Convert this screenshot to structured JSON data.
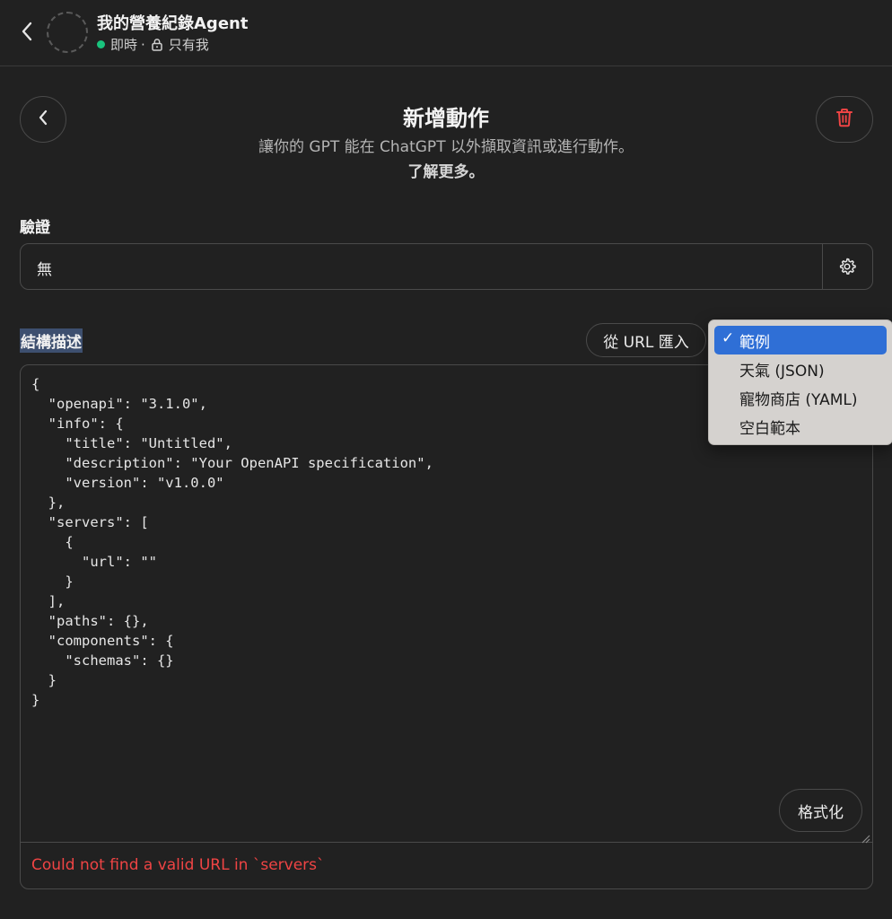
{
  "header": {
    "agent_name": "我的營養紀錄Agent",
    "status": "即時",
    "separator": "·",
    "visibility": "只有我"
  },
  "page": {
    "title": "新增動作",
    "subtitle": "讓你的 GPT 能在 ChatGPT 以外擷取資訊或進行動作。",
    "learn_more": "了解更多。"
  },
  "authentication": {
    "label": "驗證",
    "value": "無"
  },
  "schema": {
    "label": "結構描述",
    "import_button": "從 URL 匯入",
    "code": "{\n  \"openapi\": \"3.1.0\",\n  \"info\": {\n    \"title\": \"Untitled\",\n    \"description\": \"Your OpenAPI specification\",\n    \"version\": \"v1.0.0\"\n  },\n  \"servers\": [\n    {\n      \"url\": \"\"\n    }\n  ],\n  \"paths\": {},\n  \"components\": {\n    \"schemas\": {}\n  }\n}",
    "format_button": "格式化",
    "error": "Could not find a valid URL in `servers`"
  },
  "examples_menu": {
    "items": [
      {
        "label": "範例",
        "selected": true,
        "check": "✓"
      },
      {
        "label": "天氣 (JSON)",
        "selected": false
      },
      {
        "label": "寵物商店 (YAML)",
        "selected": false
      },
      {
        "label": "空白範本",
        "selected": false
      }
    ]
  },
  "colors": {
    "background": "#212121",
    "border": "#4a4a4a",
    "live_dot": "#19c37d",
    "delete_icon": "#ef4444",
    "error_text": "#ef4444",
    "menu_selected": "#2f6fd6",
    "menu_background": "#d5d2cf"
  },
  "icons": {
    "top_back": "chevron-left-icon",
    "back": "chevron-left-icon",
    "delete": "trash-icon",
    "auth_settings": "gear-icon",
    "visibility": "lock-icon",
    "menu_check": "checkmark-icon"
  }
}
